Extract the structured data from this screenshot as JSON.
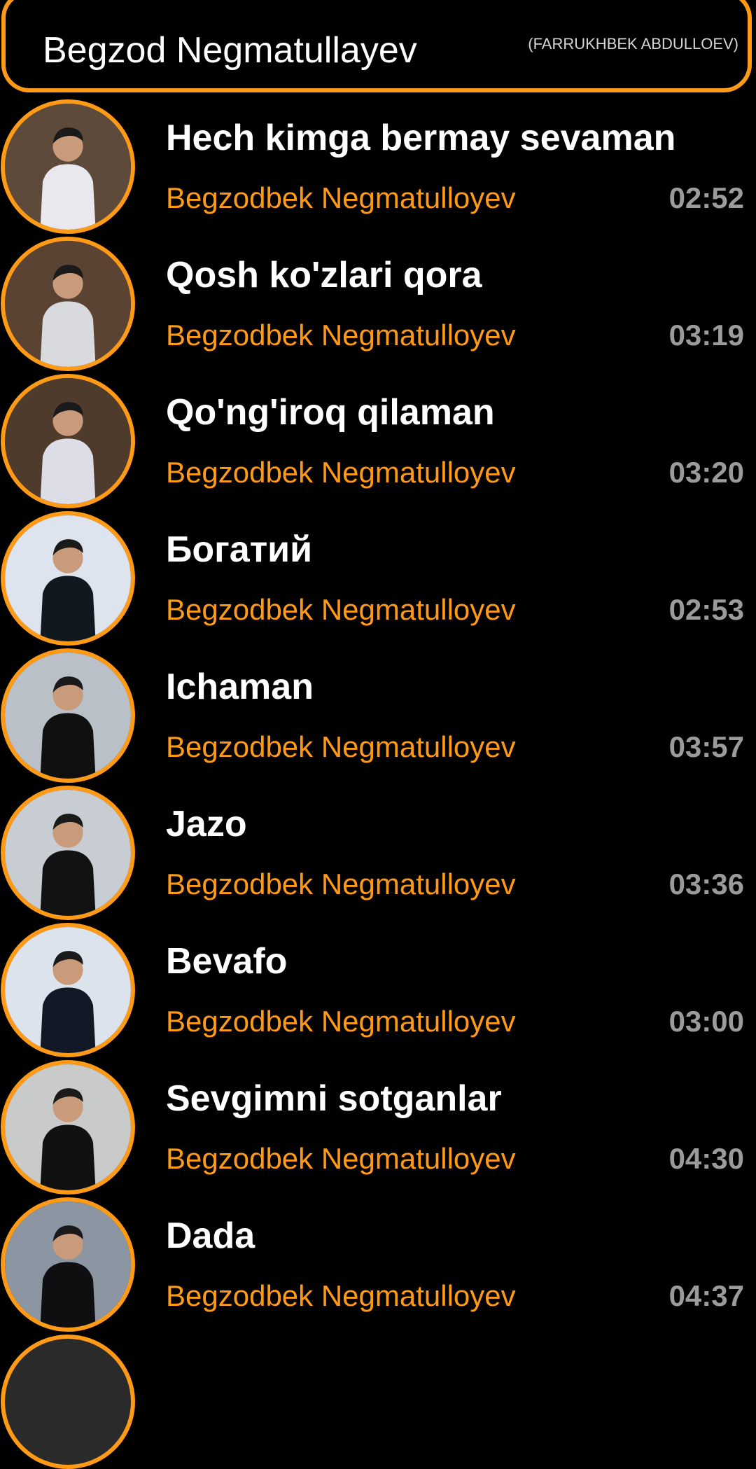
{
  "header": {
    "title": "Begzod Negmatullayev",
    "subtitle": "(FARRUKHBEK ABDULLOEV)"
  },
  "colors": {
    "accent": "#ff9a16",
    "background": "#000000",
    "title": "#ffffff",
    "duration": "#9b9b9b"
  },
  "tracks": [
    {
      "title": "Hech kimga bermay sevaman",
      "artist": "Begzodbek Negmatulloyev",
      "duration": "02:52",
      "avatar_bg": "#5d4a3b",
      "avatar_fg": "#e8e8ee"
    },
    {
      "title": "Qosh ko'zlari qora",
      "artist": "Begzodbek Negmatulloyev",
      "duration": "03:19",
      "avatar_bg": "#5b4334",
      "avatar_fg": "#d9dadd"
    },
    {
      "title": "Qo'ng'iroq qilaman",
      "artist": "Begzodbek Negmatulloyev",
      "duration": "03:20",
      "avatar_bg": "#4f3b2c",
      "avatar_fg": "#dcdde7"
    },
    {
      "title": "Богатий",
      "artist": "Begzodbek Negmatulloyev",
      "duration": "02:53",
      "avatar_bg": "#dde4ee",
      "avatar_fg": "#101820"
    },
    {
      "title": "Ichaman",
      "artist": "Begzodbek Negmatulloyev",
      "duration": "03:57",
      "avatar_bg": "#b9c0c8",
      "avatar_fg": "#101010"
    },
    {
      "title": "Jazo",
      "artist": "Begzodbek Negmatulloyev",
      "duration": "03:36",
      "avatar_bg": "#c8cdd4",
      "avatar_fg": "#121212"
    },
    {
      "title": "Bevafo",
      "artist": "Begzodbek Negmatulloyev",
      "duration": "03:00",
      "avatar_bg": "#dce3ec",
      "avatar_fg": "#121826"
    },
    {
      "title": "Sevgimni sotganlar",
      "artist": "Begzodbek Negmatulloyev",
      "duration": "04:30",
      "avatar_bg": "#c9cbcb",
      "avatar_fg": "#111111"
    },
    {
      "title": "Dada",
      "artist": "Begzodbek Negmatulloyev",
      "duration": "04:37",
      "avatar_bg": "#8c95a2",
      "avatar_fg": "#0f0f12"
    }
  ]
}
